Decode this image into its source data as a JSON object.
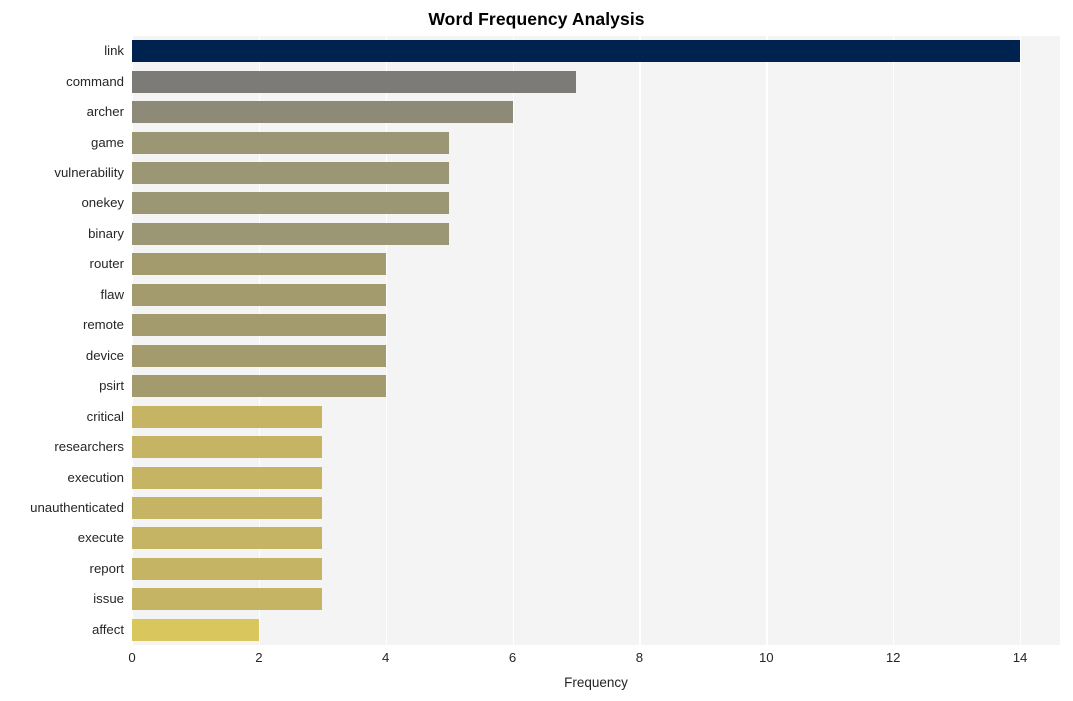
{
  "chart_data": {
    "type": "bar",
    "orientation": "horizontal",
    "title": "Word Frequency Analysis",
    "xlabel": "Frequency",
    "ylabel": "",
    "categories": [
      "link",
      "command",
      "archer",
      "game",
      "vulnerability",
      "onekey",
      "binary",
      "router",
      "flaw",
      "remote",
      "device",
      "psirt",
      "critical",
      "researchers",
      "execution",
      "unauthenticated",
      "execute",
      "report",
      "issue",
      "affect"
    ],
    "values": [
      14,
      7,
      6,
      5,
      5,
      5,
      5,
      4,
      4,
      4,
      4,
      4,
      3,
      3,
      3,
      3,
      3,
      3,
      3,
      2
    ],
    "bar_colors": [
      "#00224e",
      "#7c7b78",
      "#8d8a77",
      "#9b9673",
      "#9b9673",
      "#9b9673",
      "#9b9673",
      "#a39a6e",
      "#a39a6e",
      "#a39a6e",
      "#a39a6e",
      "#a39a6e",
      "#c4b464",
      "#c4b464",
      "#c4b464",
      "#c4b464",
      "#c4b464",
      "#c4b464",
      "#c4b464",
      "#d9c65c"
    ],
    "xlim": [
      0,
      14.63
    ],
    "xticks": [
      0,
      2,
      4,
      6,
      8,
      10,
      12,
      14
    ],
    "xtick_labels": [
      "0",
      "2",
      "4",
      "6",
      "8",
      "10",
      "12",
      "14"
    ],
    "grid": true,
    "grid_axis": "x",
    "grid_color": "#ffffff",
    "legend": null,
    "plot_background": "#f4f4f4",
    "figure_background": "#ffffff",
    "colormap": "cividis"
  }
}
